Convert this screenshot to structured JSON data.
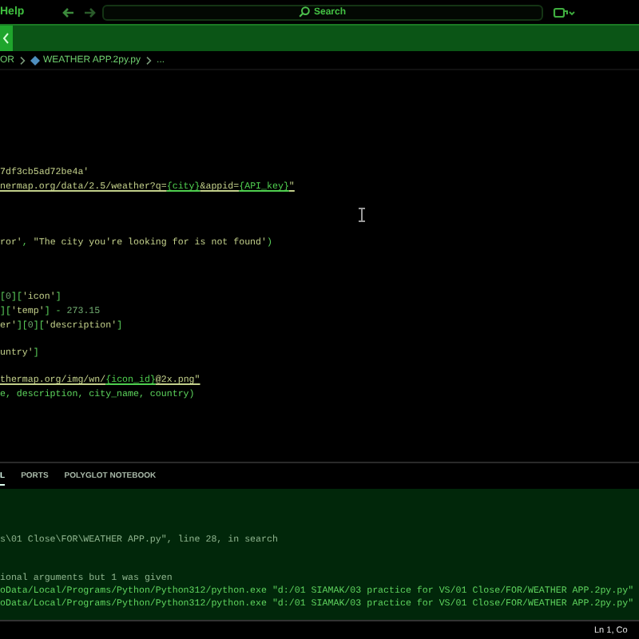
{
  "title_bar": {
    "menu": "Help",
    "search": {
      "placeholder": "Search"
    }
  },
  "breadcrumb": [
    "OR",
    "WEATHER APP.2py.py",
    "..."
  ],
  "editor": {
    "lines": [
      {
        "kind": "blank"
      },
      {
        "kind": "blank"
      },
      {
        "kind": "blank"
      },
      {
        "kind": "blank"
      },
      {
        "kind": "blank"
      },
      {
        "kind": "blank"
      },
      {
        "kind": "code",
        "segments": [
          {
            "kind": "str",
            "text": "7df3cb5ad72be4a'"
          }
        ]
      },
      {
        "kind": "code",
        "segments": [
          {
            "kind": "link",
            "text": "nermap.org/data/2.5/weather?q="
          },
          {
            "kind": "var",
            "text": "{city}"
          },
          {
            "kind": "link",
            "text": "&appid="
          },
          {
            "kind": "var",
            "text": "{API_key}"
          },
          {
            "kind": "link",
            "text": "\""
          }
        ]
      },
      {
        "kind": "blank"
      },
      {
        "kind": "blank"
      },
      {
        "kind": "blank"
      },
      {
        "kind": "code",
        "segments": [
          {
            "kind": "str",
            "text": "ror'"
          },
          {
            "kind": "plain",
            "text": ", "
          },
          {
            "kind": "str",
            "text": "\"The city you're looking for is not found'"
          },
          {
            "kind": "plain",
            "text": ")"
          }
        ]
      },
      {
        "kind": "blank"
      },
      {
        "kind": "blank"
      },
      {
        "kind": "blank"
      },
      {
        "kind": "code",
        "segments": [
          {
            "kind": "plain",
            "text": "["
          },
          {
            "kind": "num",
            "text": "0"
          },
          {
            "kind": "plain",
            "text": "]["
          },
          {
            "kind": "str",
            "text": "'icon'"
          },
          {
            "kind": "plain",
            "text": "]"
          }
        ]
      },
      {
        "kind": "code",
        "segments": [
          {
            "kind": "plain",
            "text": "]["
          },
          {
            "kind": "str",
            "text": "'temp'"
          },
          {
            "kind": "plain",
            "text": "] - "
          },
          {
            "kind": "num",
            "text": "273.15"
          }
        ]
      },
      {
        "kind": "code",
        "segments": [
          {
            "kind": "str",
            "text": "er'"
          },
          {
            "kind": "plain",
            "text": "]["
          },
          {
            "kind": "num",
            "text": "0"
          },
          {
            "kind": "plain",
            "text": "]["
          },
          {
            "kind": "str",
            "text": "'description'"
          },
          {
            "kind": "plain",
            "text": "]"
          }
        ]
      },
      {
        "kind": "blank"
      },
      {
        "kind": "code",
        "segments": [
          {
            "kind": "str",
            "text": "untry'"
          },
          {
            "kind": "plain",
            "text": "]"
          }
        ]
      },
      {
        "kind": "blank"
      },
      {
        "kind": "code",
        "segments": [
          {
            "kind": "link",
            "text": "thermap.org/img/wn/"
          },
          {
            "kind": "var",
            "text": "{icon_id}"
          },
          {
            "kind": "link",
            "text": "@2x.png\""
          }
        ]
      },
      {
        "kind": "code",
        "segments": [
          {
            "kind": "plain",
            "text": "e, description, city_name, country)"
          }
        ]
      }
    ]
  },
  "panel": {
    "tabs": [
      {
        "label": "L",
        "selected": true
      },
      {
        "label": "PORTS",
        "selected": false
      },
      {
        "label": "POLYGLOT NOTEBOOK",
        "selected": false
      }
    ],
    "terminal_lines": [
      {
        "kind": "blank"
      },
      {
        "kind": "blank"
      },
      {
        "kind": "blank"
      },
      {
        "kind": "text",
        "text": "s\\01 Close\\FOR\\WEATHER APP.py\", line 28, in search"
      },
      {
        "kind": "blank"
      },
      {
        "kind": "blank"
      },
      {
        "kind": "text",
        "text": "ional arguments but 1 was given"
      },
      {
        "kind": "command",
        "text": "oData/Local/Programs/Python/Python312/python.exe \"d:/01 SIAMAK/03 practice for VS/01 Close/FOR/WEATHER APP.2py.py\""
      },
      {
        "kind": "command",
        "text": "oData/Local/Programs/Python/Python312/python.exe \"d:/01 SIAMAK/03 practice for VS/01 Close/FOR/WEATHER APP.2py.py\""
      }
    ]
  },
  "status_bar": {
    "position": "Ln 1, Co"
  }
}
